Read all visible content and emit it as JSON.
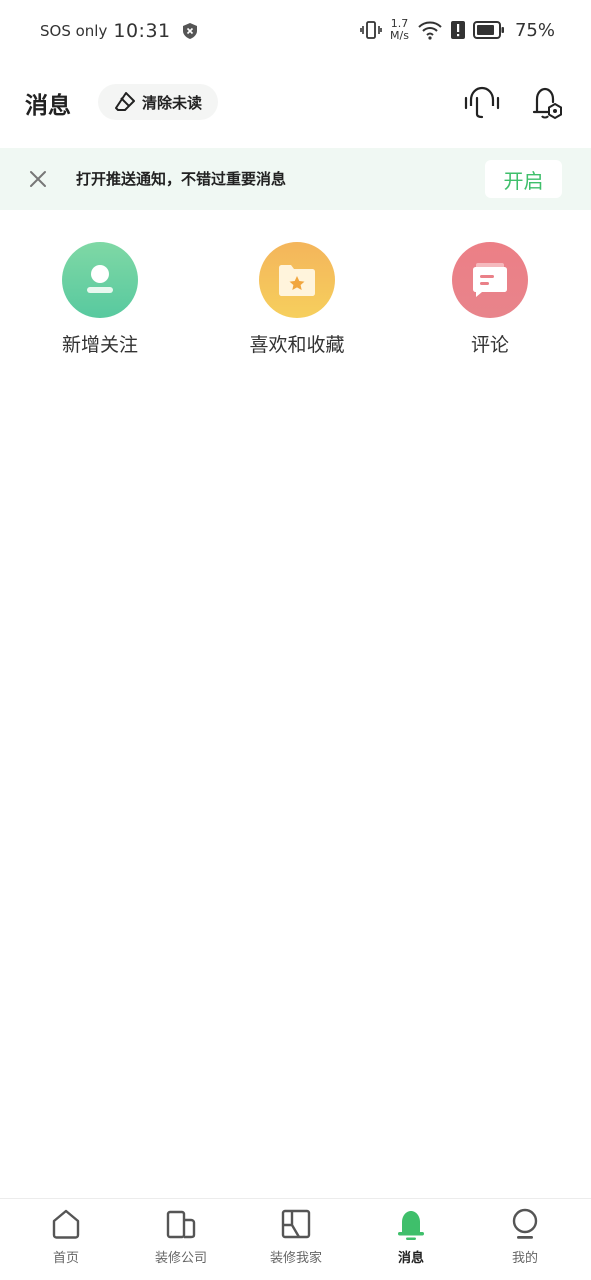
{
  "status_bar": {
    "carrier": "SOS only",
    "time": "10:31",
    "speed_value": "1.7",
    "speed_unit": "M/s",
    "battery": "75%"
  },
  "header": {
    "title": "消息",
    "clear_label": "清除未读"
  },
  "banner": {
    "text": "打开推送通知，不错过重要消息",
    "button": "开启"
  },
  "entries": [
    {
      "label": "新增关注",
      "icon": "person-icon",
      "color": "#5fcea1"
    },
    {
      "label": "喜欢和收藏",
      "icon": "folder-star-icon",
      "color": "#f4c05a"
    },
    {
      "label": "评论",
      "icon": "comment-icon",
      "color": "#ea8088"
    }
  ],
  "bottom_nav": [
    {
      "label": "首页",
      "icon": "home-icon"
    },
    {
      "label": "装修公司",
      "icon": "company-icon"
    },
    {
      "label": "装修我家",
      "icon": "house-plan-icon"
    },
    {
      "label": "消息",
      "icon": "bell-icon",
      "active": true
    },
    {
      "label": "我的",
      "icon": "profile-icon"
    }
  ],
  "colors": {
    "accent": "#3fbf6b",
    "banner_bg": "#f0f8f3"
  }
}
